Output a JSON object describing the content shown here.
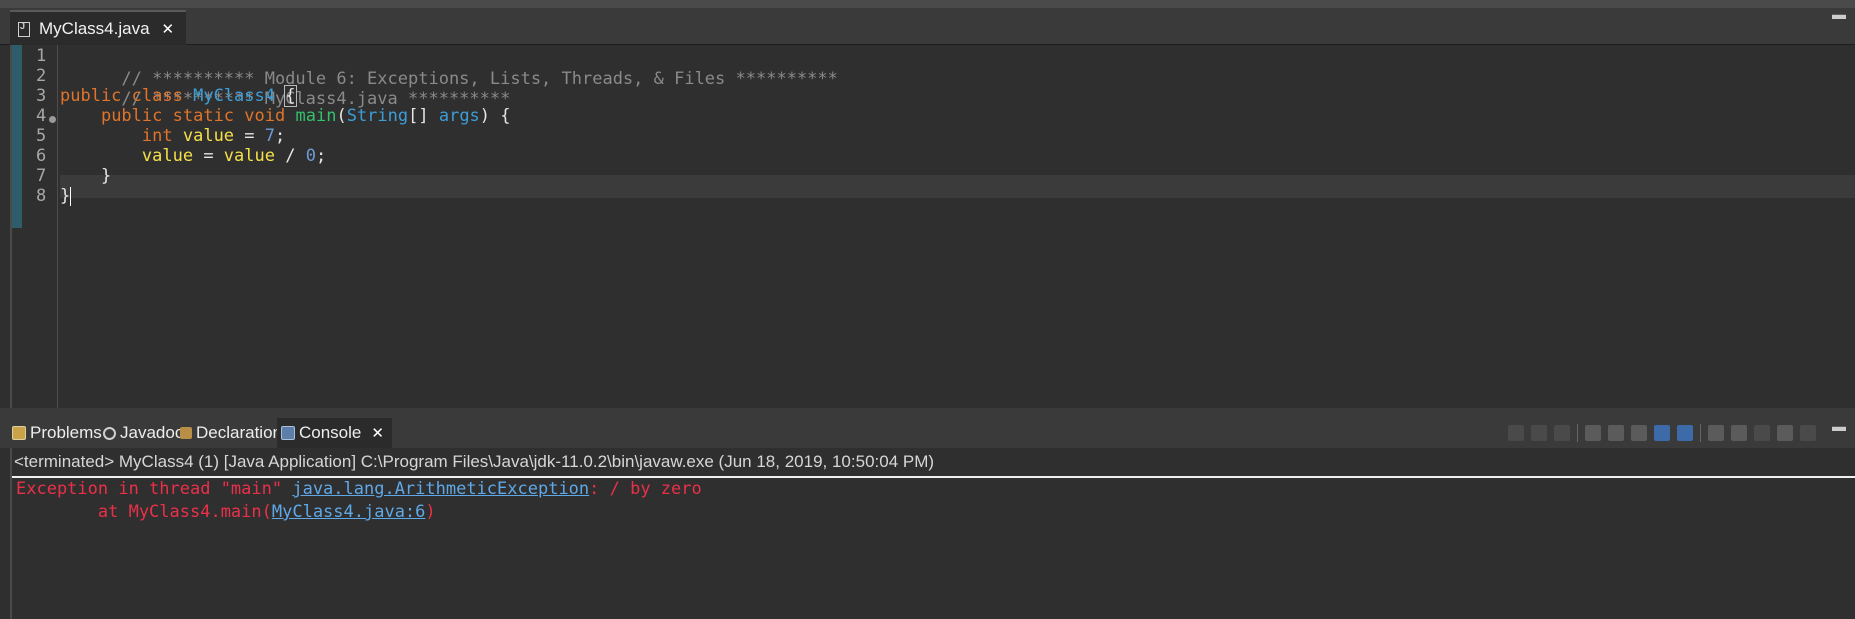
{
  "editor_tab": {
    "title": "MyClass4.java",
    "close": "✕"
  },
  "editor": {
    "line_numbers": [
      "1",
      "2",
      "3",
      "4",
      "5",
      "6",
      "7",
      "8"
    ],
    "lines": {
      "l1": "// ********** Module 6: Exceptions, Lists, Threads, & Files **********",
      "l2": "// ********** MyClass4.java **********",
      "l3": {
        "kw1": "public",
        "kw2": "class",
        "cls": "MyClass4",
        "brace": "{"
      },
      "l4": {
        "kw1": "public",
        "kw2": "static",
        "kw3": "void",
        "mth": "main",
        "p1": "(",
        "type": "String",
        "p2": "[] ",
        "arg": "args",
        "p3": ") {"
      },
      "l5": {
        "kw": "int",
        "var": "value",
        "op": " = ",
        "num": "7",
        "end": ";"
      },
      "l6": {
        "var1": "value",
        "op1": " = ",
        "var2": "value",
        "op2": " / ",
        "num": "0",
        "end": ";"
      },
      "l7": "}",
      "l8": "}"
    }
  },
  "console_tabs": [
    {
      "label": "Problems"
    },
    {
      "label": "Javadoc"
    },
    {
      "label": "Declaration"
    },
    {
      "label": "Console"
    }
  ],
  "console": {
    "title": "<terminated> MyClass4 (1) [Java Application] C:\\Program Files\\Java\\jdk-11.0.2\\bin\\javaw.exe (Jun 18, 2019, 10:50:04 PM)",
    "line1_prefix": "Exception in thread \"main\" ",
    "line1_link": "java.lang.ArithmeticException",
    "line1_suffix": ": / by zero",
    "line2_prefix": "        at MyClass4.main(",
    "line2_link": "MyClass4.java:6",
    "line2_suffix": ")"
  },
  "colors": {
    "keyword": "#e0742a",
    "class": "#3d9dd6",
    "variable": "#f5e04a",
    "method": "#34c06d",
    "error": "#ea3049",
    "link": "#5fa8e8"
  }
}
